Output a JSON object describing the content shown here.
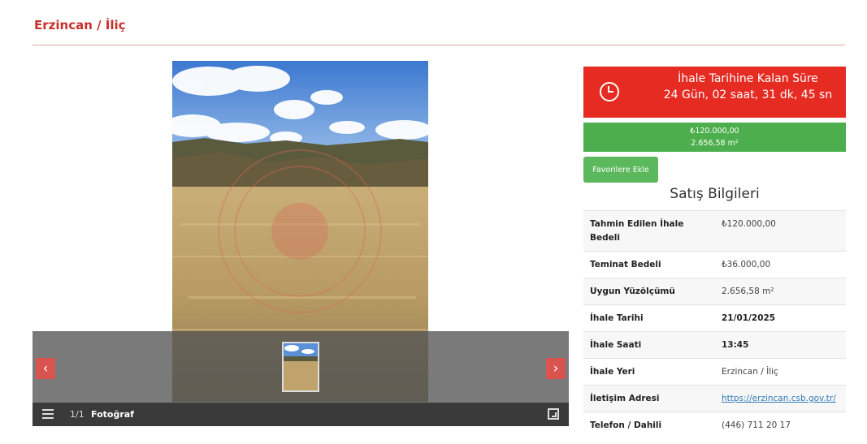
{
  "page": {
    "title": "Erzincan / İliç"
  },
  "gallery": {
    "counter": "1/1",
    "bar_label": "Fotoğraf",
    "prev_label": "‹",
    "next_label": "›"
  },
  "timer": {
    "title": "İhale Tarihine Kalan Süre",
    "value": "24 Gün, 02 saat, 31 dk, 45 sn",
    "color": "#e52b22"
  },
  "price": {
    "amount": "₺120.000,00",
    "area": "2.656,58 m²",
    "color": "#4cae4c"
  },
  "favorite_label": "Favorilere Ekle",
  "sales_info": {
    "title": "Satış Bilgileri",
    "rows": [
      {
        "label": "Tahmin Edilen İhale Bedeli",
        "value": "₺120.000,00"
      },
      {
        "label": "Teminat Bedeli",
        "value": "₺36.000,00"
      },
      {
        "label": "Uygun Yüzölçümü",
        "value": "2.656,58 m²"
      },
      {
        "label": "İhale Tarihi",
        "value": "21/01/2025"
      },
      {
        "label": "İhale Saati",
        "value": "13:45"
      },
      {
        "label": "İhale Yeri",
        "value": "Erzincan / İliç"
      },
      {
        "label": "İletişim Adresi",
        "value": "https://erzincan.csb.gov.tr/"
      },
      {
        "label": "Telefon / Dahili",
        "value": "(446) 711 20 17"
      }
    ]
  }
}
